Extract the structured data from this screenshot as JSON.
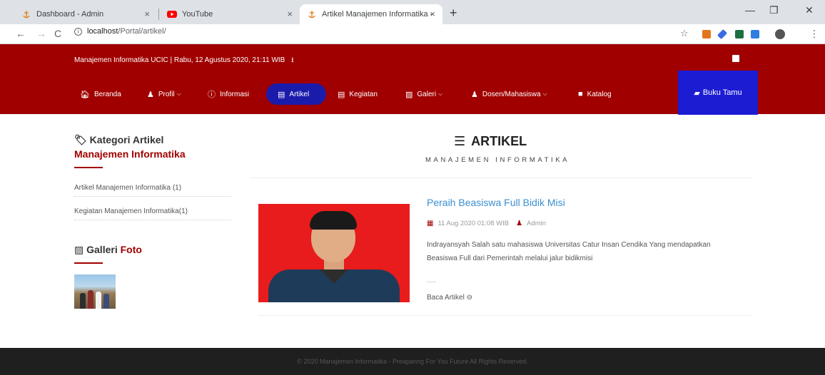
{
  "browser": {
    "tabs": [
      {
        "title": "Dashboard - Admin",
        "icon": "site-anchor-icon"
      },
      {
        "title": "YouTube",
        "icon": "youtube-icon"
      },
      {
        "title": "Artikel Manajemen Informatika - ",
        "icon": "site-anchor-icon"
      }
    ],
    "url_host": "localhost",
    "url_path": "/Portal/artikel/"
  },
  "header": {
    "info": "Manajemen Informatika UCIC | Rabu, 12 Agustus 2020, 21:11 WIB",
    "menu": {
      "beranda": "Beranda",
      "profil": "Profil",
      "informasi": "Informasi",
      "artikel": "Artikel",
      "kegiatan": "Kegiatan",
      "galeri": "Galeri",
      "dosen": "Dosen/Mahasiswa",
      "katalog": "Katalog"
    },
    "buku_tamu": "Buku Tamu",
    "colors": {
      "brand": "#a00000",
      "active_pill": "#1b1bab",
      "buku_tamu": "#1c1cd3"
    }
  },
  "sidebar": {
    "kategori_title": "Kategori Artikel",
    "kategori_subtitle": "Manajemen Informatika",
    "categories": [
      "Artikel Manajemen Informatika (1)",
      "Kegiatan Manajemen Informatika(1)"
    ],
    "galeri_title_a": "Galleri",
    "galeri_title_b": "Foto"
  },
  "main": {
    "heading": "ARTIKEL",
    "subheading": "MANAJEMEN INFORMATIKA",
    "post": {
      "title": "Peraih Beasiswa Full Bidik Misi",
      "date": "11 Aug 2020 01:08 WIB",
      "author": "Admin",
      "excerpt": "Indrayansyah Salah satu mahasiswa Universitas Catur Insan Cendika Yang mendapatkan Beasiswa Full dari Pemerintah melalui jalur bidikmisi",
      "ellipsis": ".....",
      "read_more": "Baca Artikel"
    }
  },
  "footer": {
    "text": "© 2020 Manajemen Informatika - Preaparing For You Future All Rights Reserved."
  }
}
